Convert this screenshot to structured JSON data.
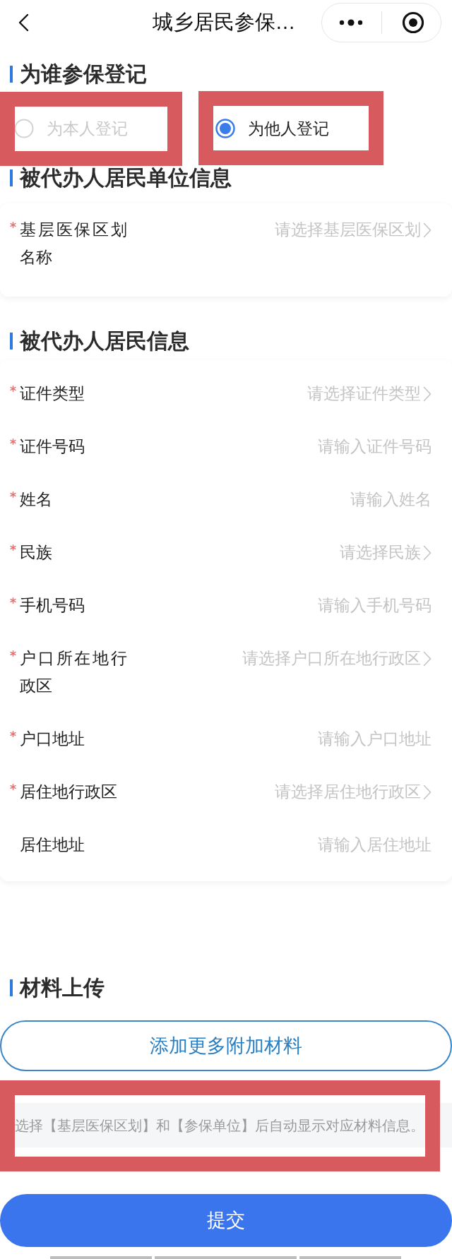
{
  "nav": {
    "title": "城乡居民参保…"
  },
  "sections": [
    {
      "kind": "radio",
      "heading": "为谁参保登记",
      "options": [
        {
          "label": "为本人登记",
          "selected": false,
          "highlighted": true
        },
        {
          "label": "为他人登记",
          "selected": true,
          "highlighted": true
        }
      ]
    },
    {
      "kind": "form",
      "heading": "被代办人居民单位信息",
      "fields": [
        {
          "label": "基层医保区划名称",
          "required": true,
          "kind": "select",
          "placeholder": "请选择基层医保区划"
        }
      ]
    },
    {
      "kind": "form",
      "heading": "被代办人居民信息",
      "fields": [
        {
          "label": "证件类型",
          "required": true,
          "kind": "select",
          "placeholder": "请选择证件类型"
        },
        {
          "label": "证件号码",
          "required": true,
          "kind": "input",
          "placeholder": "请输入证件号码"
        },
        {
          "label": "姓名",
          "required": true,
          "kind": "input",
          "placeholder": "请输入姓名"
        },
        {
          "label": "民族",
          "required": true,
          "kind": "select",
          "placeholder": "请选择民族"
        },
        {
          "label": "手机号码",
          "required": true,
          "kind": "input",
          "placeholder": "请输入手机号码"
        },
        {
          "label": "户口所在地行政区",
          "required": true,
          "kind": "select",
          "placeholder": "请选择户口所在地行政区"
        },
        {
          "label": "户口地址",
          "required": true,
          "kind": "input",
          "placeholder": "请输入户口地址"
        },
        {
          "label": "居住地行政区",
          "required": true,
          "kind": "select",
          "placeholder": "请选择居住地行政区"
        },
        {
          "label": "居住地址",
          "required": false,
          "kind": "input",
          "placeholder": "请输入居住地址"
        }
      ]
    },
    {
      "kind": "materials",
      "heading": "材料上传",
      "add_button": "添加更多附加材料",
      "notice": {
        "text": "选择【基层医保区划】和【参保单位】后自动显示对应材料信息。",
        "highlighted": true
      }
    }
  ],
  "submit_button": "提交"
}
